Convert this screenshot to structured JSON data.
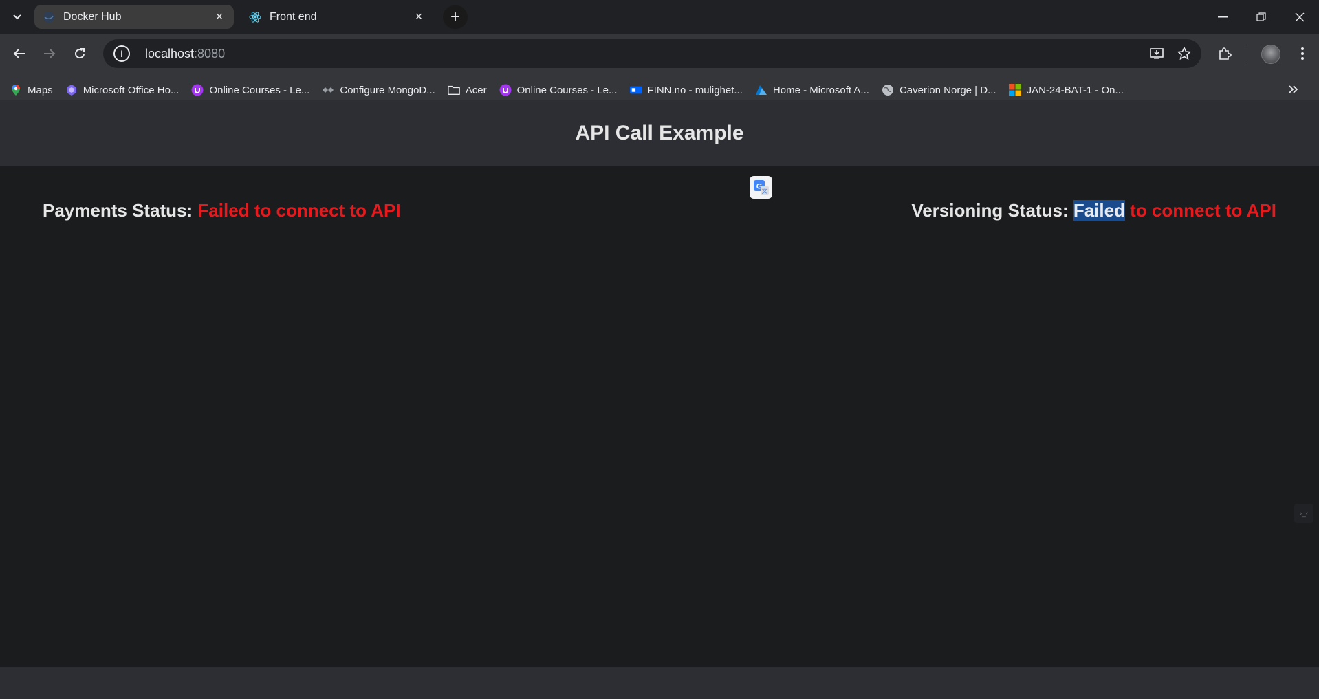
{
  "browser": {
    "tabs": [
      {
        "title": "Docker Hub",
        "icon": "docker-icon",
        "active": true
      },
      {
        "title": "Front end",
        "icon": "react-icon",
        "active": false
      }
    ],
    "address": {
      "host": "localhost",
      "port": ":8080"
    },
    "bookmarks": [
      {
        "label": "Maps",
        "icon": "maps-icon"
      },
      {
        "label": "Microsoft Office Ho...",
        "icon": "office-icon"
      },
      {
        "label": "Online Courses - Le...",
        "icon": "udemy-icon"
      },
      {
        "label": "Configure MongoD...",
        "icon": "mongodb-icon"
      },
      {
        "label": "Acer",
        "icon": "folder-icon"
      },
      {
        "label": "Online Courses - Le...",
        "icon": "udemy-icon"
      },
      {
        "label": "FINN.no - mulighet...",
        "icon": "finn-icon"
      },
      {
        "label": "Home - Microsoft A...",
        "icon": "azure-icon"
      },
      {
        "label": "Caverion Norge | D...",
        "icon": "globe-icon"
      },
      {
        "label": "JAN-24-BAT-1 - On...",
        "icon": "microsoft-icon"
      }
    ]
  },
  "page": {
    "title": "API Call Example",
    "payments": {
      "label": "Payments Status:",
      "value": "Failed to connect to API"
    },
    "versioning": {
      "label": "Versioning Status:",
      "value_selected": "Failed",
      "value_rest": " to connect to API"
    }
  },
  "colors": {
    "error": "#e8191d",
    "header_bg": "#2c2e33",
    "page_bg": "#1b1c1e"
  }
}
